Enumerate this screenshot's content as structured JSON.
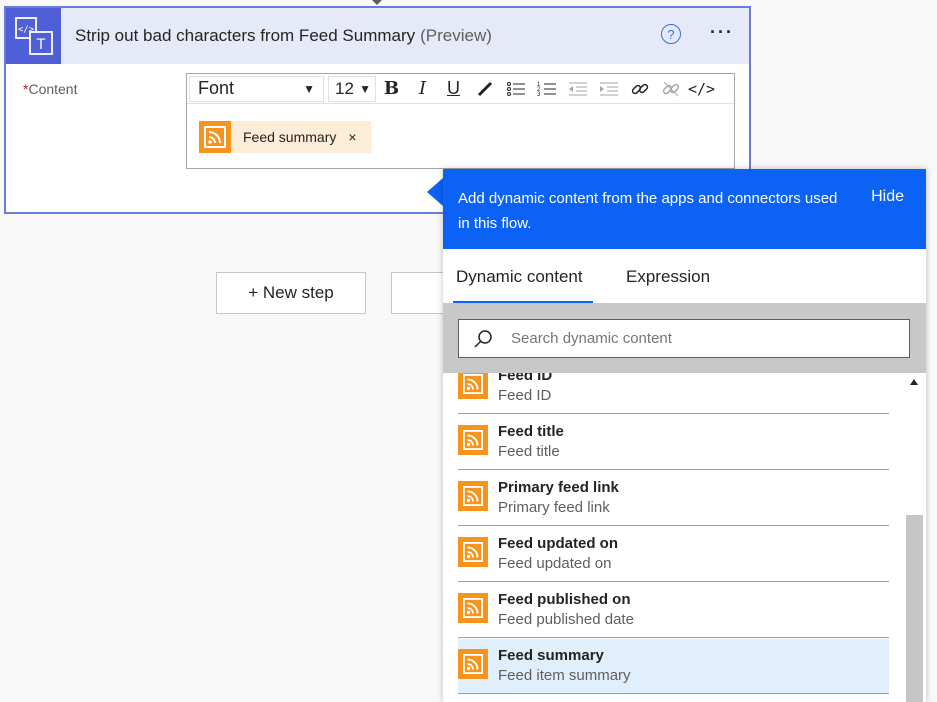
{
  "action": {
    "title": "Strip out bad characters from Feed Summary",
    "preview": "(Preview)",
    "help_icon": "question-circle-icon",
    "more_icon": "ellipsis-icon",
    "more_label": "···",
    "help_label": "?"
  },
  "content_field": {
    "required_mark": "*",
    "label": "Content",
    "font_select": "Font",
    "size_select": "12",
    "token_label": "Feed summary",
    "token_remove": "×"
  },
  "toolbar": {
    "bold": "B",
    "italic": "I",
    "underline": "U"
  },
  "new_step": {
    "label": "+ New step"
  },
  "dynamic_panel": {
    "header_text": "Add dynamic content from the apps and connectors used in this flow.",
    "hide_label": "Hide",
    "tabs": [
      "Dynamic content",
      "Expression"
    ],
    "search_placeholder": "Search dynamic content",
    "items": [
      {
        "title": "Feed ID",
        "description": "Feed ID"
      },
      {
        "title": "Feed title",
        "description": "Feed title"
      },
      {
        "title": "Primary feed link",
        "description": "Primary feed link"
      },
      {
        "title": "Feed updated on",
        "description": "Feed updated on"
      },
      {
        "title": "Feed published on",
        "description": "Feed published date"
      },
      {
        "title": "Feed summary",
        "description": "Feed item summary"
      }
    ]
  },
  "colors": {
    "accent": "#0b62f5",
    "action_icon_bg": "#4f5fd8",
    "rss": "#f7941d",
    "token_bg": "#fcecd8",
    "selected_row": "#e1effd"
  }
}
